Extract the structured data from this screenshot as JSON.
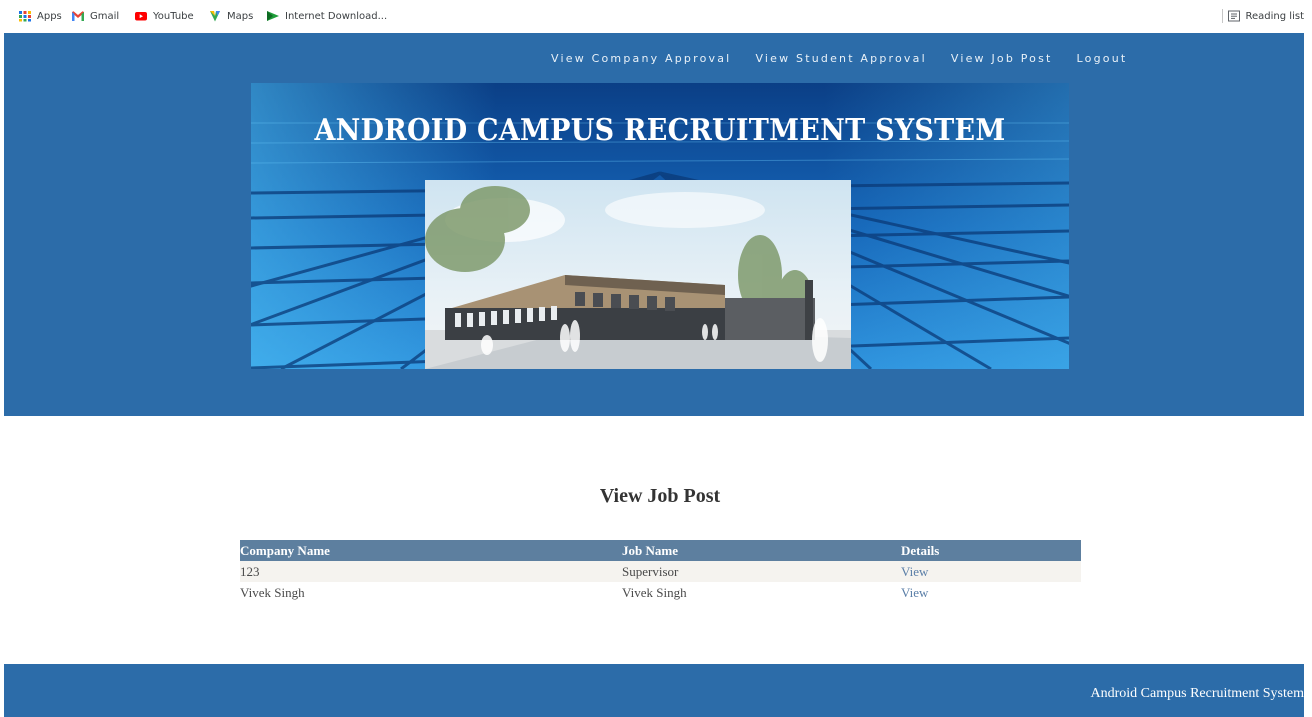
{
  "bookmarks": {
    "items": [
      {
        "label": "Apps",
        "icon": "apps-grid-icon"
      },
      {
        "label": "Gmail",
        "icon": "gmail-icon"
      },
      {
        "label": "YouTube",
        "icon": "youtube-icon"
      },
      {
        "label": "Maps",
        "icon": "maps-icon"
      },
      {
        "label": "Internet Download...",
        "icon": "idm-icon"
      }
    ],
    "reading_list": "Reading list"
  },
  "nav": {
    "company_approval": "View Company Approval",
    "student_approval": "View Student Approval",
    "job_post": "View Job Post",
    "logout": "Logout"
  },
  "banner": {
    "title": "ANDROID CAMPUS RECRUITMENT SYSTEM"
  },
  "main": {
    "title": "View Job Post",
    "table": {
      "headers": [
        "Company Name",
        "Job Name",
        "Details"
      ],
      "rows": [
        {
          "company": "123",
          "job": "Supervisor",
          "details": "View"
        },
        {
          "company": "Vivek Singh",
          "job": "Vivek Singh",
          "details": "View"
        }
      ]
    }
  },
  "footer": {
    "text": "Android Campus Recruitment System"
  },
  "colors": {
    "header_bg": "#2c6ca9",
    "table_header_bg": "#5d7f9f",
    "link": "#5a7ea7"
  }
}
